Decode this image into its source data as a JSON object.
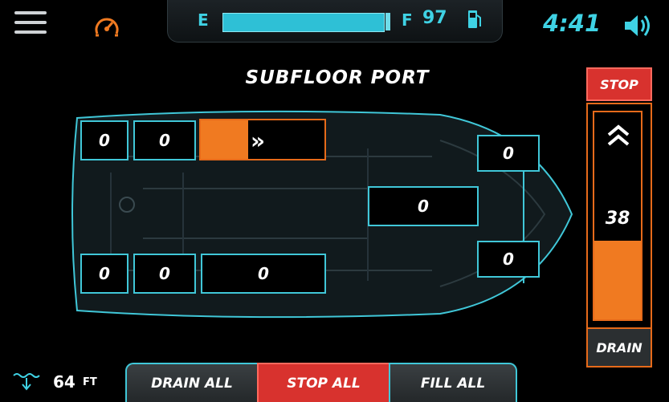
{
  "topbar": {
    "fuel_empty_label": "E",
    "fuel_full_label": "F",
    "fuel_level": "97",
    "clock": "4:41",
    "icons": [
      "menu-icon",
      "gauge-icon",
      "fuel-pump-icon",
      "speaker-icon"
    ]
  },
  "title": "SUBFLOOR PORT",
  "ballast": {
    "top_left": "0",
    "top_mid": "0",
    "top_right_fill_pct": 38,
    "right_upper": "0",
    "center": "0",
    "right_lower": "0",
    "bottom_left": "0",
    "bottom_mid": "0",
    "bottom_right": "0"
  },
  "control": {
    "stop_label": "STOP",
    "level": "38",
    "drain_label": "DRAIN"
  },
  "depth": {
    "value": "64",
    "unit": "FT"
  },
  "buttons": {
    "drain_all": "DRAIN ALL",
    "stop_all": "STOP ALL",
    "fill_all": "FILL ALL"
  },
  "colors": {
    "accent": "#40c7d8",
    "orange": "#f07a21",
    "red": "#d8322e"
  }
}
